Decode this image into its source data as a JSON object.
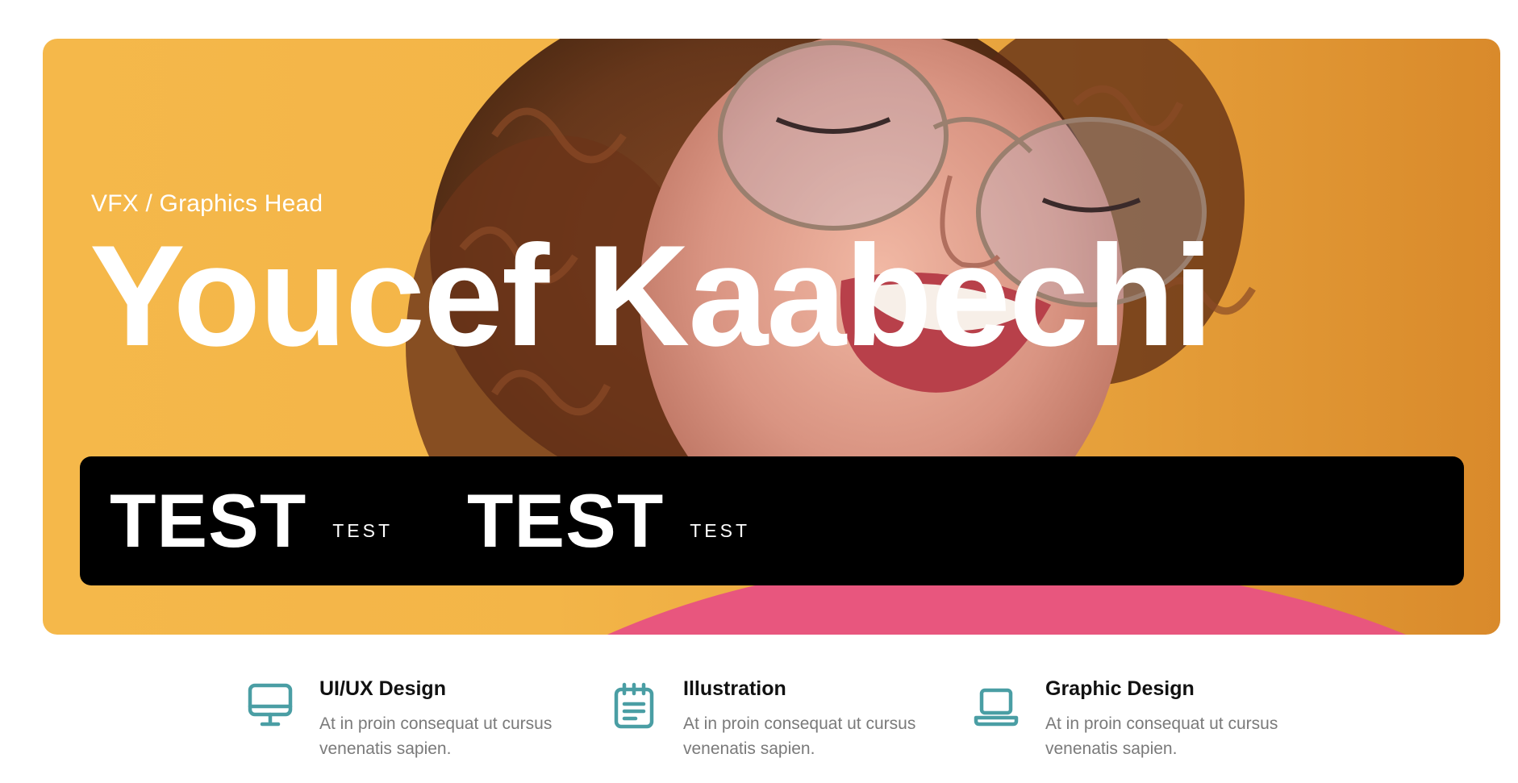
{
  "hero": {
    "subtitle": "VFX / Graphics Head",
    "name": "Youcef Kaabechi"
  },
  "stats": [
    {
      "value": "TEST",
      "label": "TEST"
    },
    {
      "value": "TEST",
      "label": "TEST"
    }
  ],
  "services": [
    {
      "icon": "monitor-icon",
      "title": "UI/UX Design",
      "desc": "At in proin consequat ut cursus venenatis sapien."
    },
    {
      "icon": "notepad-icon",
      "title": "Illustration",
      "desc": "At in proin consequat ut cursus venenatis sapien."
    },
    {
      "icon": "laptop-icon",
      "title": "Graphic Design",
      "desc": "At in proin consequat ut cursus venenatis sapien."
    }
  ],
  "colors": {
    "accent": "#4a9ea4",
    "hero_bg": "#f3b548",
    "stats_bg": "#000000"
  }
}
